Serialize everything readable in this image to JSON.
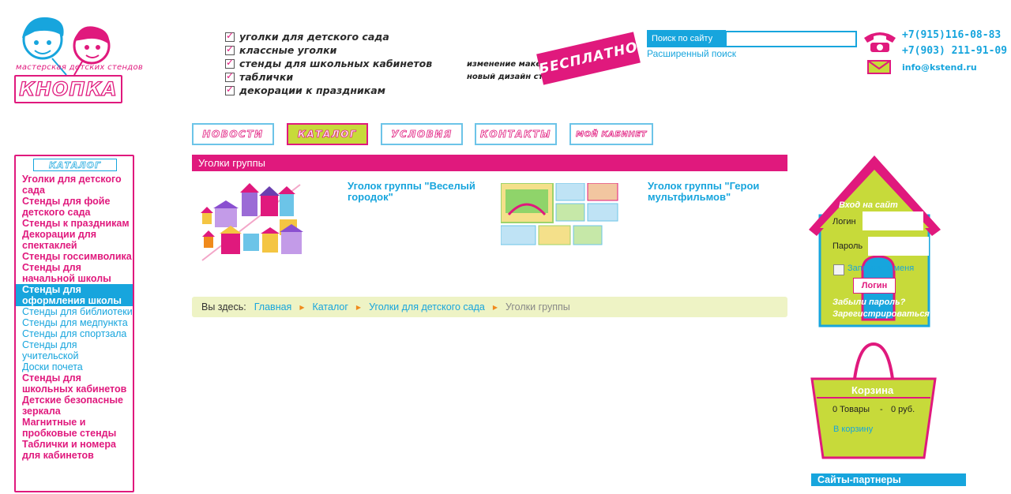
{
  "brand": {
    "tagline": "мастерская детских стендов",
    "name": "КНОПКА"
  },
  "header_list": [
    "уголки для детского сада",
    "классные уголки",
    "стенды для школьных кабинетов",
    "таблички",
    "декорации к праздникам"
  ],
  "promo": {
    "line1": "изменение макета",
    "line2": "новый дизайн стендов",
    "badge": "БЕСПЛАТНО"
  },
  "search": {
    "label": "Поиск по сайту",
    "value": "",
    "advanced": "Расширенный поиск"
  },
  "contacts": {
    "phone1": "+7(915)116-08-83",
    "phone2": "+7(903) 211-91-09",
    "email": "info@kstend.ru"
  },
  "nav": [
    "НОВОСТИ",
    "КАТАЛОГ",
    "УСЛОВИЯ",
    "КОНТАКТЫ",
    "МОЙ КАБИНЕТ"
  ],
  "sidebar": {
    "title": "КАТАЛОГ",
    "items": [
      {
        "label": "Уголки для детского сада",
        "style": "bold"
      },
      {
        "label": "Стенды для фойе детского сада",
        "style": "bold"
      },
      {
        "label": "Стенды к праздникам",
        "style": "bold"
      },
      {
        "label": "Декорации для спектаклей",
        "style": "bold"
      },
      {
        "label": "Стенды госсимволика",
        "style": "bold"
      },
      {
        "label": "Стенды для начальной школы",
        "style": "bold"
      },
      {
        "label": "Стенды для оформления школы",
        "style": "selected"
      },
      {
        "label": "Стенды для библиотеки",
        "style": "sub"
      },
      {
        "label": "Стенды для медпункта",
        "style": "sub"
      },
      {
        "label": "Стенды для спортзала",
        "style": "sub"
      },
      {
        "label": "Стенды для учительской",
        "style": "sub"
      },
      {
        "label": "Доски почета",
        "style": "sub"
      },
      {
        "label": "Стенды для школьных кабинетов",
        "style": "bold"
      },
      {
        "label": "Детские безопасные зеркала",
        "style": "bold"
      },
      {
        "label": "Магнитные и пробковые стенды",
        "style": "bold"
      },
      {
        "label": "Таблички и номера для кабинетов",
        "style": "bold"
      }
    ]
  },
  "main": {
    "title": "Уголки группы",
    "products": [
      {
        "title": "Уголок группы \"Веселый городок\""
      },
      {
        "title": "Уголок группы \"Герои мультфильмов\""
      }
    ]
  },
  "breadcrumb": {
    "prefix": "Вы здесь:",
    "items": [
      "Главная",
      "Каталог",
      "Уголки для детского сада"
    ],
    "current": "Уголки группы"
  },
  "login": {
    "title": "Вход на сайт",
    "login_label": "Логин",
    "password_label": "Пароль",
    "remember": "Запомнить меня",
    "button": "Логин",
    "forgot": "Забыли пароль?",
    "register": "Зарегистрироваться"
  },
  "cart": {
    "title": "Корзина",
    "items_count": "0 Товары",
    "dash": "-",
    "sum": "0 руб.",
    "link": "В корзину"
  },
  "partners": {
    "title": "Сайты-партнеры"
  },
  "colors": {
    "pink": "#e0197d",
    "blue": "#17a5dd",
    "lime": "#c7da3a"
  }
}
